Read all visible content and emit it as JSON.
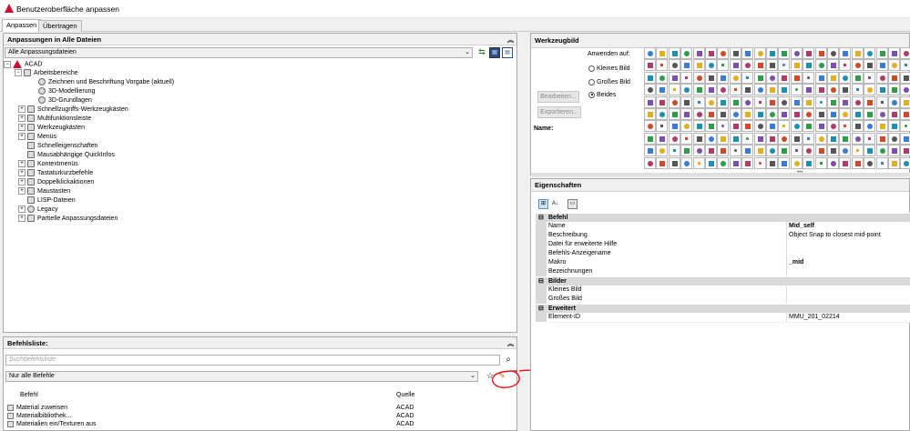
{
  "window": {
    "title": "Benutzeroberfläche anpassen"
  },
  "tabs": [
    {
      "label": "Anpassen"
    },
    {
      "label": "Übertragen"
    }
  ],
  "customizations": {
    "header": "Anpassungen in Alle Dateien",
    "filter_value": "Alle Anpassungsdateien",
    "tree": [
      {
        "label": "ACAD",
        "level": 0
      },
      {
        "label": "Arbeitsbereiche",
        "level": 1
      },
      {
        "label": "Zeichnen und Beschriftung Vorgabe (aktuell)",
        "level": 2
      },
      {
        "label": "3D-Modellierung",
        "level": 2
      },
      {
        "label": "3D-Grundlagen",
        "level": 2
      },
      {
        "label": "Schnellzugriffs-Werkzeugkästen",
        "level": 1
      },
      {
        "label": "Multifunktionsleiste",
        "level": 1
      },
      {
        "label": "Werkzeugkästen",
        "level": 1
      },
      {
        "label": "Menüs",
        "level": 1
      },
      {
        "label": "Schnelleigenschaften",
        "level": 1
      },
      {
        "label": "Mausabhängige QuickInfos",
        "level": 1
      },
      {
        "label": "Kontextmenüs",
        "level": 1
      },
      {
        "label": "Tastaturkurzbefehle",
        "level": 1
      },
      {
        "label": "Doppelklickaktionen",
        "level": 1
      },
      {
        "label": "Maustasten",
        "level": 1
      },
      {
        "label": "LISP-Dateien",
        "level": 1
      },
      {
        "label": "Legacy",
        "level": 1
      },
      {
        "label": "Partielle Anpassungsdateien",
        "level": 1
      }
    ]
  },
  "command_list": {
    "header": "Befehlsliste:",
    "search_placeholder": "Suchbefehlsliste",
    "filter_value": "Nur alle Befehle",
    "col_command": "Befehl",
    "col_source": "Quelle",
    "rows": [
      {
        "command": "Material zuweisen",
        "source": "ACAD"
      },
      {
        "command": "Materialbibliothek...",
        "source": "ACAD"
      },
      {
        "command": "Materialien ein/Texturen aus",
        "source": "ACAD"
      }
    ]
  },
  "button_image": {
    "header": "Werkzeugbild",
    "apply_to_label": "Anwenden auf:",
    "radio_small": "Kleines Bild",
    "radio_large": "Großes Bild",
    "radio_both": "Beides",
    "edit_button": "Bearbeiten...",
    "export_button": "Exportieren...",
    "name_label": "Name:"
  },
  "properties": {
    "header": "Eigenschaften",
    "categories": [
      {
        "name": "Befehl",
        "rows": [
          {
            "key": "Name",
            "value": "Mid_self",
            "bold": true
          },
          {
            "key": "Beschreibung",
            "value": "Object Snap to closest mid-point",
            "bold": false
          },
          {
            "key": "Datei für erweiterte Hilfe",
            "value": "",
            "bold": false
          },
          {
            "key": "Befehls-Anzeigename",
            "value": "",
            "bold": false
          },
          {
            "key": "Makro",
            "value": "_mid",
            "bold": true
          },
          {
            "key": "Bezeichnungen",
            "value": "",
            "bold": false
          }
        ]
      },
      {
        "name": "Bilder",
        "rows": [
          {
            "key": "Kleines Bild",
            "value": "",
            "bold": false
          },
          {
            "key": "Großes Bild",
            "value": "",
            "bold": false
          }
        ]
      },
      {
        "name": "Erweitert",
        "rows": [
          {
            "key": "Element-ID",
            "value": "MMU_201_02214",
            "bold": false
          }
        ]
      }
    ]
  },
  "colors": {
    "annotation_red": "#e8121f",
    "acad_red": "#c8102e"
  }
}
